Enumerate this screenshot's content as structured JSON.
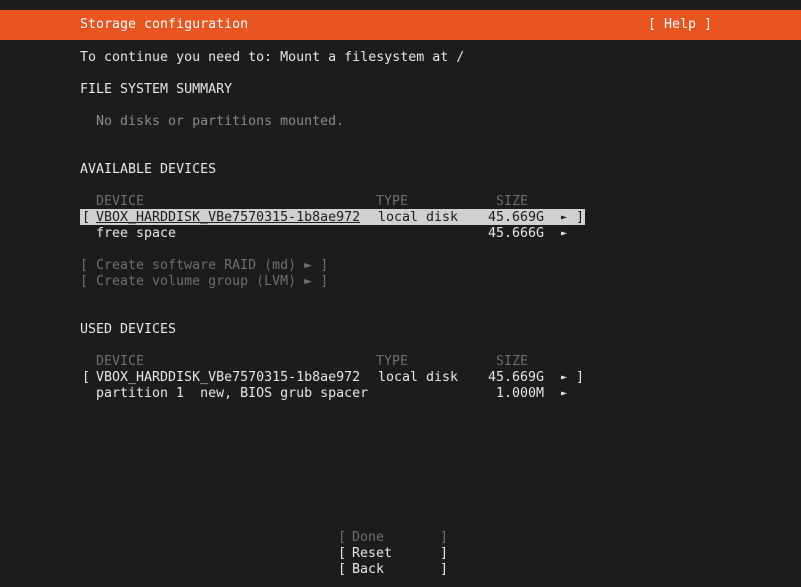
{
  "header": {
    "title": "Storage configuration",
    "help_button": "[ Help ]"
  },
  "instructions": "To continue you need to: Mount a filesystem at /",
  "fs_summary": {
    "heading": "FILE SYSTEM SUMMARY",
    "empty_message": "No disks or partitions mounted."
  },
  "available": {
    "heading": "AVAILABLE DEVICES",
    "columns": {
      "device": "DEVICE",
      "type": "TYPE",
      "size": "SIZE"
    },
    "rows": [
      {
        "open": "[",
        "device": "VBOX_HARDDISK_VBe7570315-1b8ae972",
        "type": "local disk",
        "size": "45.669G",
        "arrow": "►",
        "close": "]"
      },
      {
        "device": "free space",
        "type": "",
        "size": "45.666G",
        "arrow": "►"
      }
    ],
    "actions": [
      {
        "label": "[ Create software RAID (md) ► ]"
      },
      {
        "label": "[ Create volume group (LVM) ► ]"
      }
    ]
  },
  "used": {
    "heading": "USED DEVICES",
    "columns": {
      "device": "DEVICE",
      "type": "TYPE",
      "size": "SIZE"
    },
    "rows": [
      {
        "open": "[",
        "device": "VBOX_HARDDISK_VBe7570315-1b8ae972",
        "type": "local disk",
        "size": "45.669G",
        "arrow": "►",
        "close": "]"
      },
      {
        "device": "partition 1  new, BIOS grub spacer",
        "size": "1.000M",
        "arrow": "►"
      }
    ]
  },
  "buttons": {
    "done": {
      "open": "[",
      "label": "Done",
      "close": "]"
    },
    "reset": {
      "open": "[",
      "label": "Reset",
      "close": "]"
    },
    "back": {
      "open": "[",
      "label": "Back",
      "close": "]"
    }
  },
  "colors": {
    "header_bg": "#e95420",
    "background": "#1c1c1c",
    "text": "#e6e6e6",
    "selection_bg": "#d0d0d0"
  }
}
